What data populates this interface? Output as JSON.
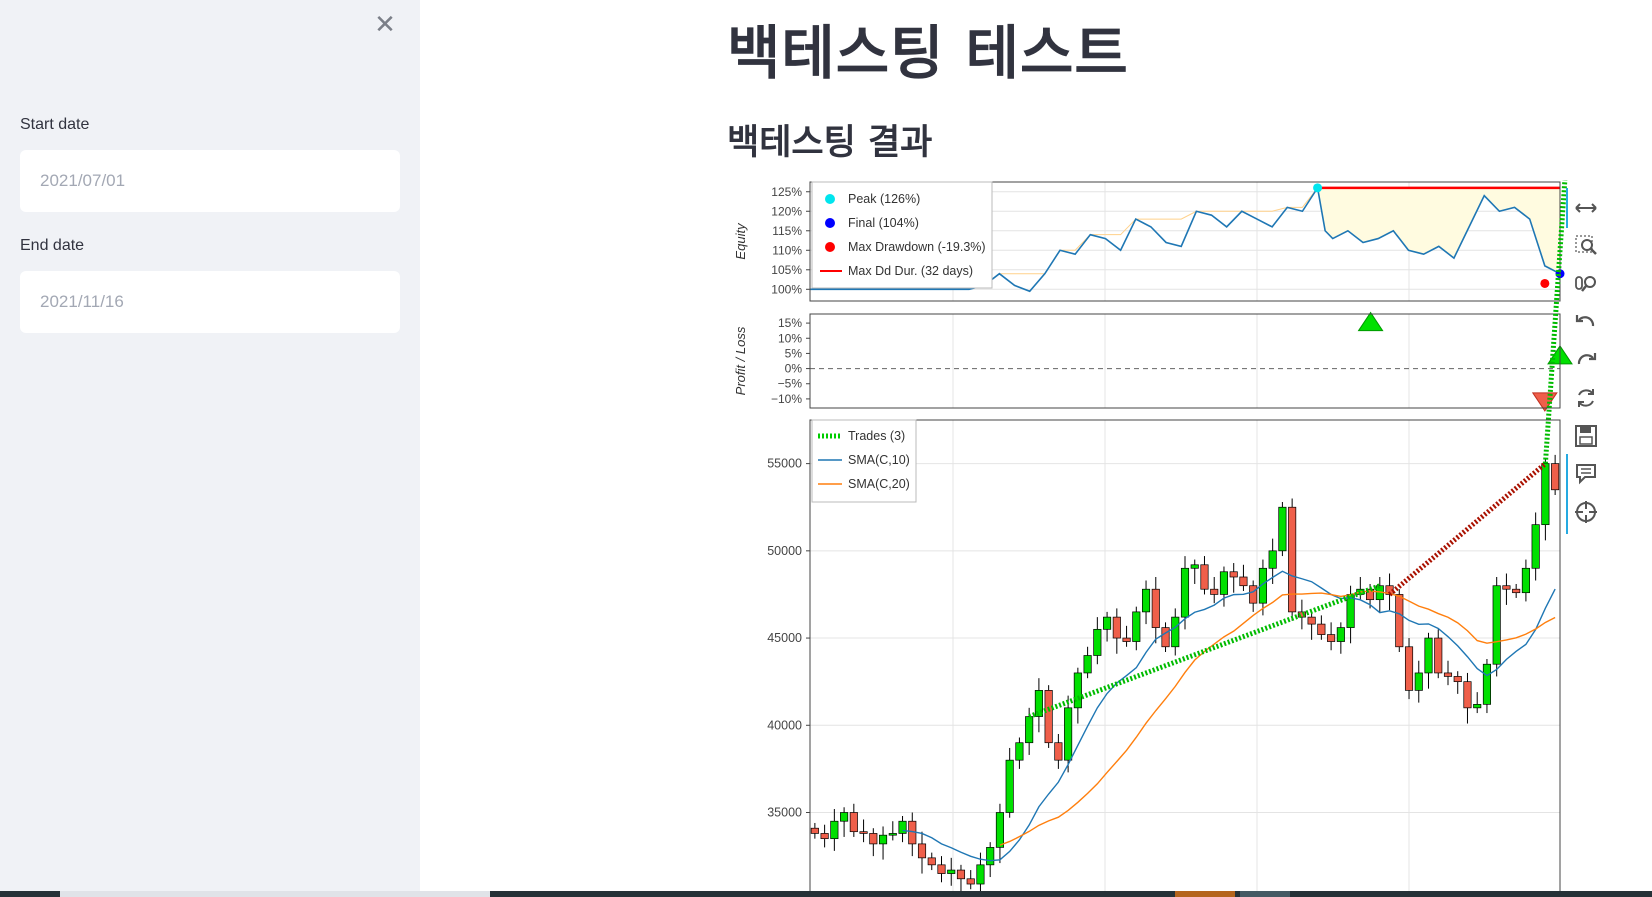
{
  "sidebar": {
    "close_symbol": "✕",
    "start_date": {
      "label": "Start date",
      "placeholder": "2021/07/01"
    },
    "end_date": {
      "label": "End date",
      "placeholder": "2021/11/16"
    }
  },
  "main": {
    "title": "백테스팅 테스트",
    "section_title": "백테스팅 결과"
  },
  "toolbar": {
    "tools": [
      "pan-icon",
      "box-zoom-icon",
      "wheel-zoom-icon",
      "undo-icon",
      "redo-icon",
      "reset-icon",
      "save-icon",
      "hover-icon",
      "crosshair-icon"
    ]
  },
  "colors": {
    "sidebar_bg": "#f0f2f6",
    "candle_up": "#00e000",
    "candle_down": "#ef5f4a",
    "sma10": "#1f77b4",
    "sma20": "#ff7f0e",
    "equity_line": "#1f77b4",
    "drawdown_fill": "#fffbe0"
  },
  "chart_data": [
    {
      "type": "line",
      "name": "equity",
      "ylabel": "Equity",
      "yticks": [
        "100%",
        "105%",
        "110%",
        "115%",
        "120%",
        "125%"
      ],
      "ylim": [
        97,
        127.5
      ],
      "legend": [
        {
          "label": "Peak (126%)",
          "marker": "dot",
          "color": "#00e5ee"
        },
        {
          "label": "Final (104%)",
          "marker": "dot",
          "color": "#0000ff"
        },
        {
          "label": "Max Drawdown (-19.3%)",
          "marker": "dot",
          "color": "#ff0000"
        },
        {
          "label": "Max Dd Dur. (32 days)",
          "marker": "line",
          "color": "#ff0000"
        }
      ],
      "legend_position": "top-left",
      "x": [
        0,
        3,
        6,
        9,
        12,
        15,
        18,
        21,
        23,
        25,
        27,
        29,
        31,
        33,
        35,
        37,
        39,
        41,
        43,
        45,
        47,
        49,
        51,
        53,
        55,
        57,
        59,
        61,
        63,
        65,
        67,
        68,
        69,
        71,
        73,
        75,
        77,
        79,
        81,
        83,
        85,
        87,
        89,
        91,
        93,
        95,
        97,
        99
      ],
      "values": [
        100,
        100,
        100,
        100,
        100,
        100,
        100,
        100,
        101,
        104,
        101,
        99.5,
        104,
        110,
        109,
        114,
        113,
        110,
        118,
        116,
        112,
        111,
        120,
        119,
        116,
        120,
        118,
        116,
        121,
        120,
        126,
        115,
        113,
        115,
        112,
        113,
        115,
        110,
        109,
        111,
        108,
        116,
        124,
        120,
        121,
        118,
        106,
        104
      ],
      "peak": {
        "x": 67,
        "value": 126,
        "label": "Peak (126%)"
      },
      "max_drawdown": {
        "x": 97,
        "value": 101.5,
        "label": "Max Drawdown (-19.3%)"
      },
      "final": {
        "x": 99,
        "value": 104,
        "label": "Final (104%)"
      },
      "max_dd_duration": {
        "x_start": 67,
        "x_end": 99,
        "value": 126
      }
    },
    {
      "type": "scatter",
      "name": "profit_loss",
      "ylabel": "Profit / Loss",
      "yticks": [
        "15%",
        "10%",
        "5%",
        "0%",
        "−5%",
        "−10%"
      ],
      "ylim": [
        -13,
        18
      ],
      "trades": [
        {
          "x": 74,
          "value": 15.5,
          "result": "win"
        },
        {
          "x": 99,
          "value": 4.5,
          "result": "win"
        },
        {
          "x": 97,
          "value": -11,
          "result": "loss"
        }
      ]
    },
    {
      "type": "candlestick",
      "name": "ohlc",
      "yticks": [
        "35000",
        "40000",
        "45000",
        "50000",
        "55000"
      ],
      "ylim": [
        30500,
        57500
      ],
      "legend": [
        {
          "label": "Trades (3)",
          "style": "dotted",
          "color": "#00cc00"
        },
        {
          "label": "SMA(C,10)",
          "style": "line",
          "color": "#1f77b4"
        },
        {
          "label": "SMA(C,20)",
          "style": "line",
          "color": "#ff7f0e"
        }
      ],
      "legend_position": "top-left",
      "close": [
        33800,
        33500,
        34500,
        35000,
        33900,
        33800,
        33200,
        33700,
        33800,
        34500,
        33200,
        32400,
        32000,
        31500,
        31700,
        31200,
        30900,
        32000,
        33000,
        35000,
        38000,
        39000,
        40500,
        42000,
        39000,
        38000,
        41000,
        43000,
        44000,
        45500,
        46200,
        45000,
        44800,
        46500,
        47800,
        45600,
        44500,
        46200,
        49000,
        49200,
        47800,
        47500,
        48800,
        48500,
        48000,
        47000,
        49000,
        50000,
        52500,
        46500,
        46200,
        45800,
        45200,
        44800,
        45600,
        47500,
        47800,
        47200,
        48000,
        47500,
        44500,
        42000,
        43000,
        45000,
        43000,
        42800,
        42500,
        41000,
        41200,
        43500,
        48000,
        47800,
        47600,
        49000,
        51500,
        55000,
        53500
      ]
    }
  ],
  "trades": [
    {
      "from_index": 22,
      "to_index": 58,
      "result": "win"
    },
    {
      "from_index": 59,
      "to_index": 75,
      "result": "loss"
    },
    {
      "from_index": 75,
      "to_index": 77,
      "result": "win"
    }
  ]
}
